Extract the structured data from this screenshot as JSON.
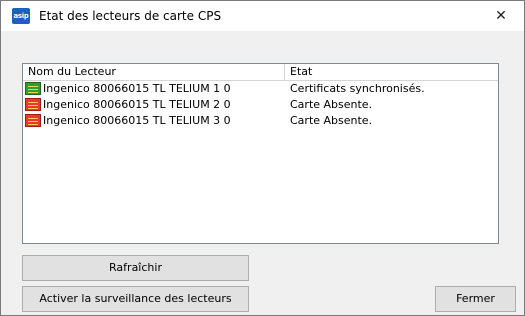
{
  "window": {
    "title": "Etat des lecteurs de carte CPS",
    "icon_text": "asip",
    "close_glyph": "✕"
  },
  "list": {
    "columns": [
      "Nom du Lecteur",
      "Etat"
    ],
    "rows": [
      {
        "name": "Ingenico 80066015 TL TELIUM 1 0",
        "state": "Certificats synchronisés.",
        "icon": "card-reader-ok-icon",
        "status_color": "#2fa02f"
      },
      {
        "name": "Ingenico 80066015 TL TELIUM 2 0",
        "state": "Carte Absente.",
        "icon": "card-reader-absent-icon",
        "status_color": "#e8392a"
      },
      {
        "name": "Ingenico 80066015 TL TELIUM 3 0",
        "state": "Carte Absente.",
        "icon": "card-reader-absent-icon",
        "status_color": "#e8392a"
      }
    ]
  },
  "buttons": {
    "refresh": "Rafraîchir",
    "monitor": "Activer la surveillance des lecteurs",
    "close": "Fermer"
  }
}
